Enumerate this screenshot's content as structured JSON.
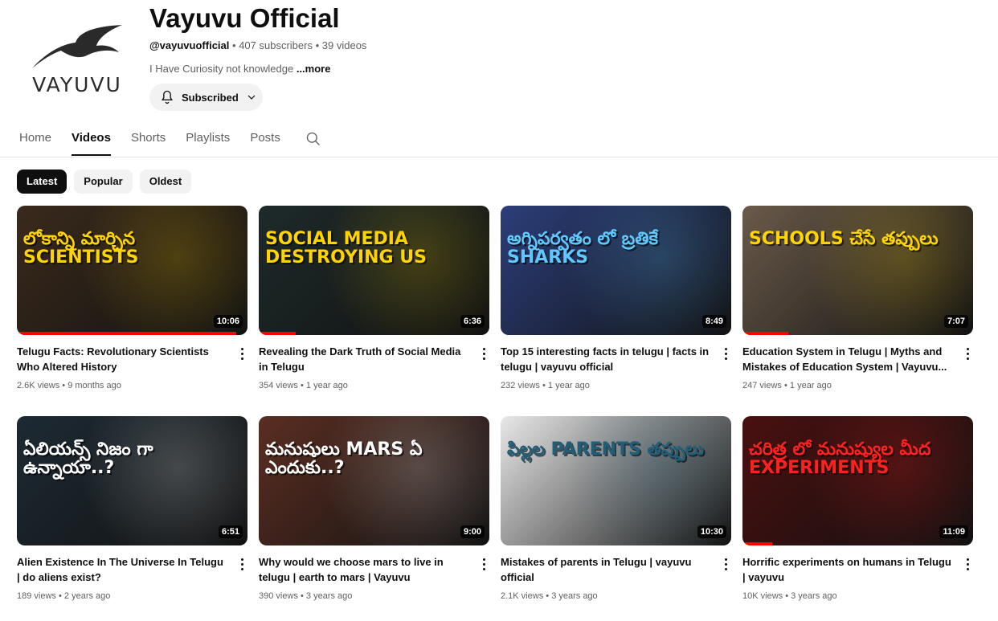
{
  "channel": {
    "name": "Vayuvu Official",
    "logo_text": "VAYUVU",
    "handle": "@vayuvuofficial",
    "subscribers": "407 subscribers",
    "videos_count": "39 videos",
    "separator": "•",
    "description": "I Have Curiosity not knowledge",
    "more_label": "...more",
    "subscribe_label": "Subscribed"
  },
  "tabs": [
    {
      "label": "Home"
    },
    {
      "label": "Videos",
      "active": true
    },
    {
      "label": "Shorts"
    },
    {
      "label": "Playlists"
    },
    {
      "label": "Posts"
    }
  ],
  "chips": [
    {
      "label": "Latest",
      "active": true
    },
    {
      "label": "Popular"
    },
    {
      "label": "Oldest"
    }
  ],
  "videos": [
    {
      "title": "Telugu Facts: Revolutionary Scientists Who Altered History",
      "views": "2.6K views",
      "age": "9 months ago",
      "duration": "10:06",
      "headline": "లోకాన్ని మార్చిన SCIENTISTS",
      "progress": 0.95,
      "bg": "#3a2a1c",
      "accent": "#ffd400"
    },
    {
      "title": "Revealing the Dark Truth of Social Media in Telugu",
      "views": "354 views",
      "age": "1 year ago",
      "duration": "6:36",
      "headline": "SOCIAL MEDIA DESTROYING US",
      "progress": 0.16,
      "bg": "#1e2a2a",
      "accent": "#ffd400"
    },
    {
      "title": "Top 15 interesting facts in telugu | facts in telugu | vayuvu official",
      "views": "232 views",
      "age": "1 year ago",
      "duration": "8:49",
      "headline": "అగ్నిపర్వతం లో బ్రతికే SHARKS",
      "progress": 0,
      "bg": "#2c3e7a",
      "accent": "#5fc8ff"
    },
    {
      "title": "Education System in Telugu | Myths and Mistakes of Education System | Vayuvu...",
      "views": "247 views",
      "age": "1 year ago",
      "duration": "7:07",
      "headline": "SCHOOLS చేసే తప్పులు",
      "progress": 0.2,
      "bg": "#6a5a4a",
      "accent": "#ffd400"
    },
    {
      "title": "Alien Existence In The Universe In Telugu | do aliens exist?",
      "views": "189 views",
      "age": "2 years ago",
      "duration": "6:51",
      "headline": "ఏలియన్స్ నిజం గా ఉన్నాయా..?",
      "progress": 0,
      "bg": "#1d2a33",
      "accent": "#ffffff"
    },
    {
      "title": "Why would we choose mars to live in telugu | earth to mars | Vayuvu",
      "views": "390 views",
      "age": "3 years ago",
      "duration": "9:00",
      "headline": "మనుషులు MARS ఏ ఎందుకు..?",
      "progress": 0,
      "bg": "#5a2e22",
      "accent": "#ffffff"
    },
    {
      "title": "Mistakes of parents in Telugu | vayuvu official",
      "views": "2.1K views",
      "age": "3 years ago",
      "duration": "10:30",
      "headline": "పిల్లల PARENTS తప్పులు",
      "progress": 0,
      "bg": "#e8e8e8",
      "accent": "#1f5f7a"
    },
    {
      "title": "Horrific experiments on humans in Telugu | vayuvu",
      "views": "10K views",
      "age": "3 years ago",
      "duration": "11:09",
      "headline": "చరిత్ర లో మనుష్యుల మీద EXPERIMENTS",
      "progress": 0.13,
      "bg": "#4a1010",
      "accent": "#ff2020"
    }
  ]
}
